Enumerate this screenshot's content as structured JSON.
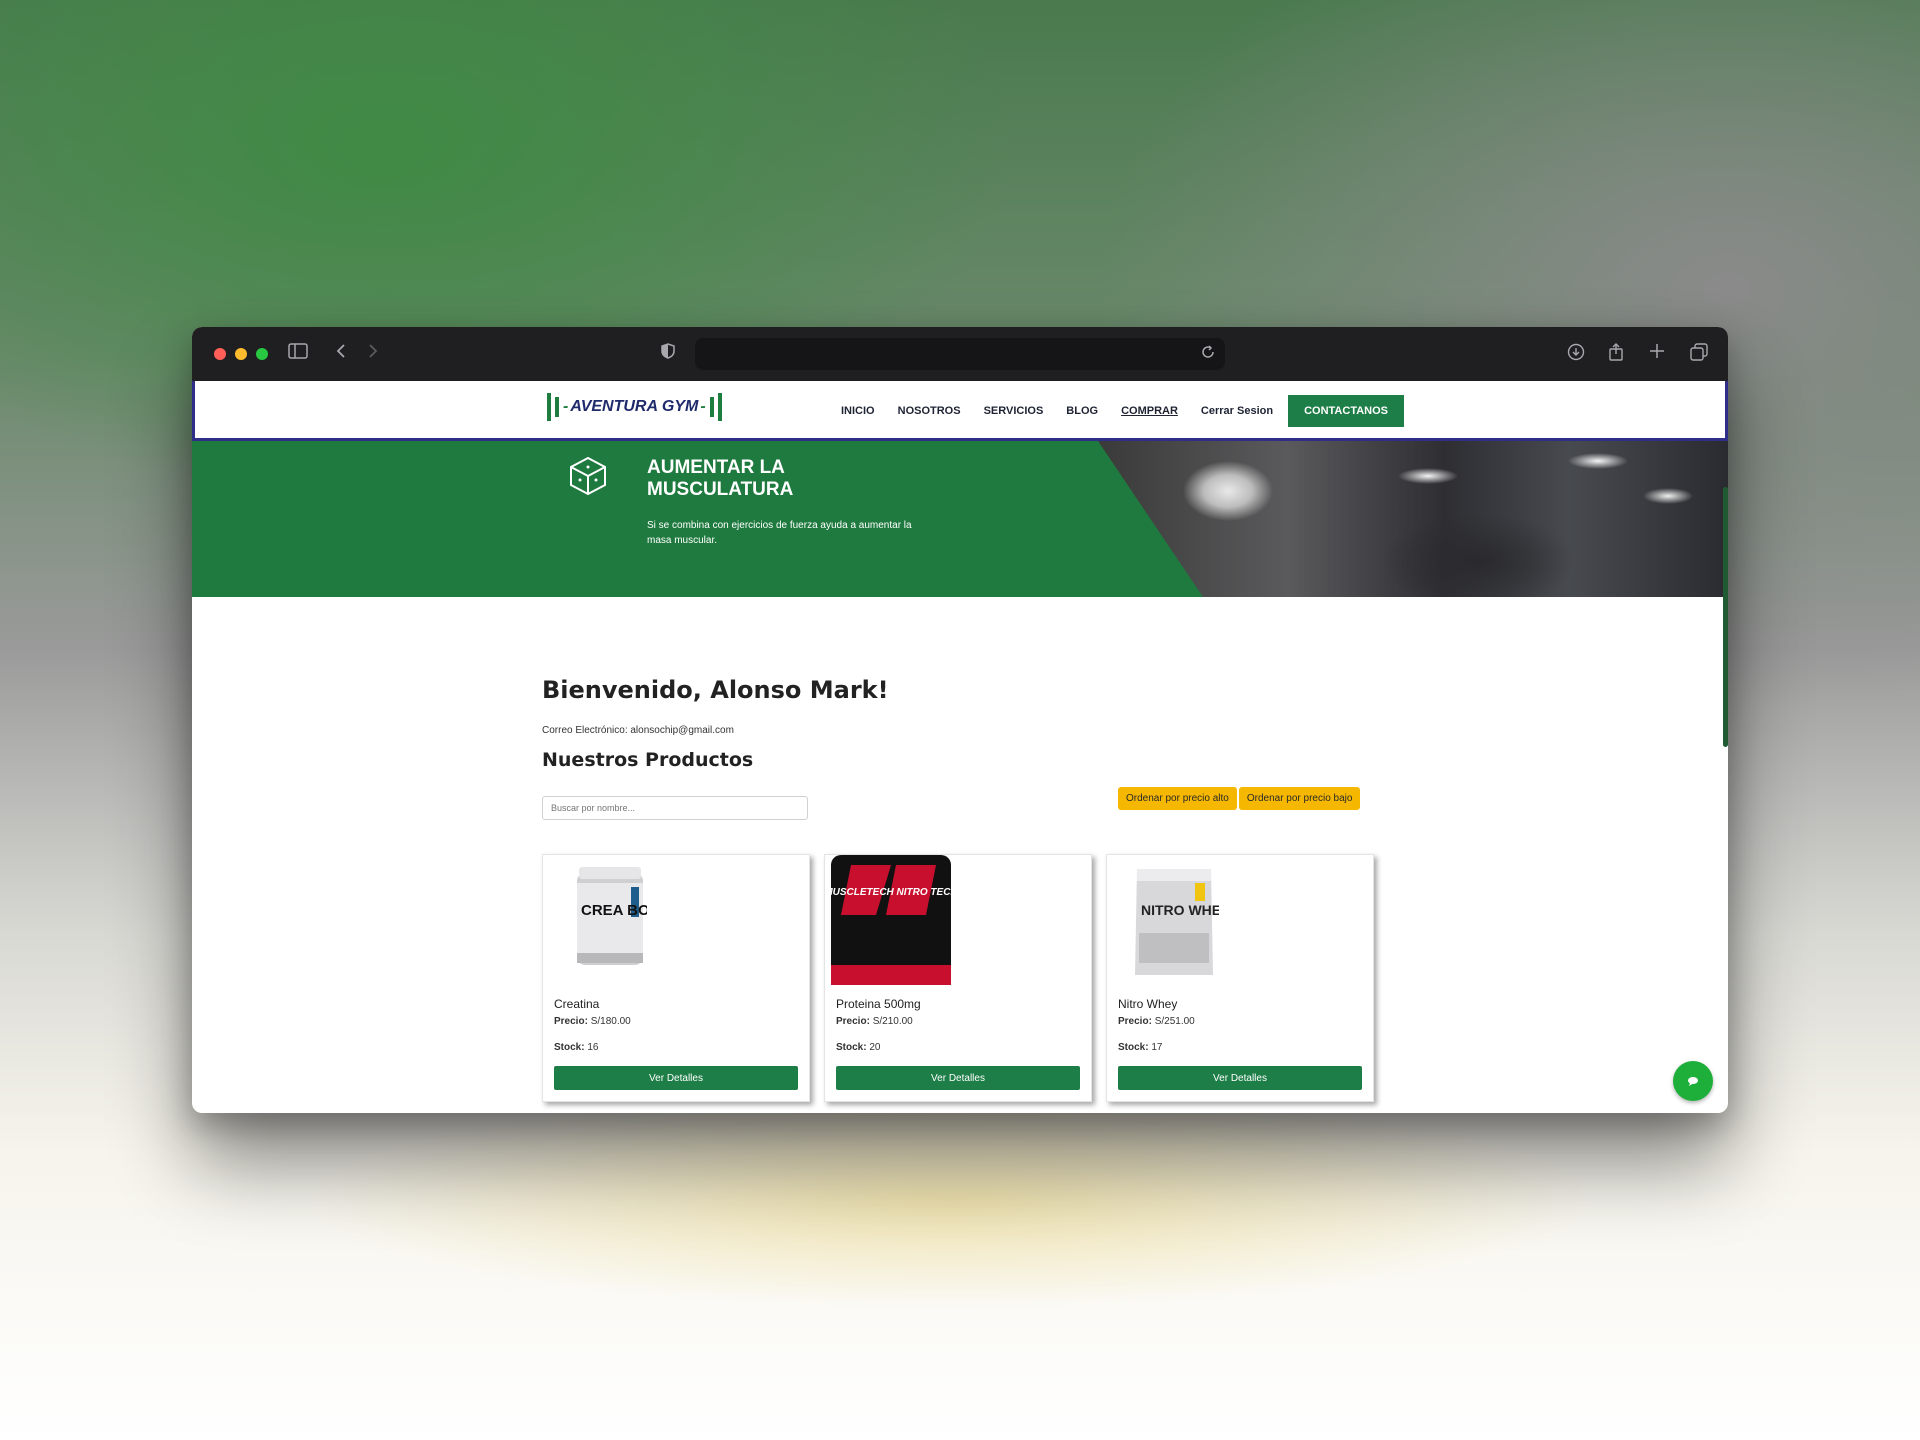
{
  "brand": {
    "logo_text": "AVENTURA GYM",
    "primary_color": "#1e7e47",
    "accent_color": "#f5b700"
  },
  "nav": {
    "items": [
      {
        "label": "INICIO"
      },
      {
        "label": "NOSOTROS"
      },
      {
        "label": "SERVICIOS"
      },
      {
        "label": "BLOG"
      },
      {
        "label": "COMPRAR"
      }
    ],
    "logout": "Cerrar Sesion",
    "contact": "CONTACTANOS"
  },
  "hero": {
    "title": "AUMENTAR LA MUSCULATURA",
    "text": "Si se combina con ejercicios de fuerza ayuda a aumentar la masa muscular."
  },
  "main": {
    "welcome": "Bienvenido, Alonso Mark!",
    "email": "Correo Electrónico: alonsochip@gmail.com",
    "products_title": "Nuestros Productos",
    "search_placeholder": "Buscar por nombre...",
    "sort_high": "Ordenar por precio alto",
    "sort_low": "Ordenar por precio bajo"
  },
  "products": [
    {
      "name": "Creatina",
      "price_label": "Precio:",
      "price": "S/180.00",
      "stock_label": "Stock:",
      "stock": "16",
      "button": "Ver Detalles",
      "image_text": "CREA BOLIC"
    },
    {
      "name": "Proteina 500mg",
      "price_label": "Precio:",
      "price": "S/210.00",
      "stock_label": "Stock:",
      "stock": "20",
      "button": "Ver Detalles",
      "image_text": "MUSCLETECH NITRO TECH"
    },
    {
      "name": "Nitro Whey",
      "price_label": "Precio:",
      "price": "S/251.00",
      "stock_label": "Stock:",
      "stock": "17",
      "button": "Ver Detalles",
      "image_text": "NITRO WHEY"
    }
  ]
}
